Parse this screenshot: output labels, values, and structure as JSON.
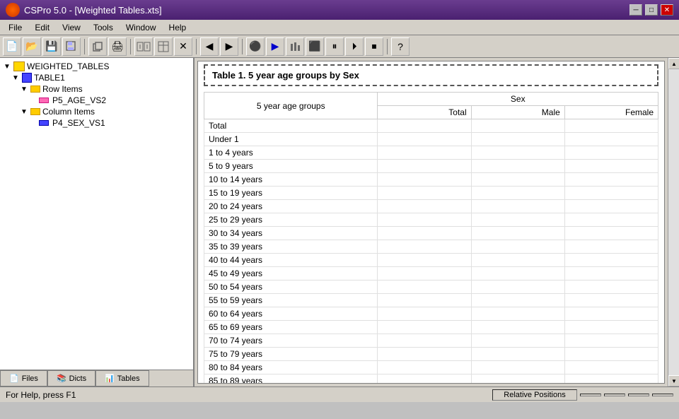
{
  "titlebar": {
    "title": "CSPro 5.0 - [Weighted Tables.xts]",
    "icon": "cspro-icon",
    "controls": [
      "minimize",
      "maximize",
      "close"
    ]
  },
  "menubar": {
    "items": [
      "File",
      "Edit",
      "View",
      "Tools",
      "Window",
      "Help"
    ]
  },
  "toolbar": {
    "buttons": [
      "new",
      "open",
      "save",
      "save-all",
      "copy",
      "print",
      "add-dict",
      "add-table",
      "remove",
      "prev",
      "next",
      "run-off",
      "run",
      "run-freq",
      "stop",
      "pause",
      "play",
      "stop2",
      "help"
    ]
  },
  "left_panel": {
    "tree": {
      "root": "WEIGHTED_TABLES",
      "items": [
        {
          "level": 1,
          "label": "TABLE1",
          "icon": "table"
        },
        {
          "level": 2,
          "label": "Row Items",
          "icon": "folder"
        },
        {
          "level": 3,
          "label": "P5_AGE_VS2",
          "icon": "pink"
        },
        {
          "level": 2,
          "label": "Column Items",
          "icon": "folder"
        },
        {
          "level": 3,
          "label": "P4_SEX_VS1",
          "icon": "blue"
        }
      ]
    },
    "tabs": [
      "Files",
      "Dicts",
      "Tables"
    ]
  },
  "table": {
    "title": "Table 1. 5 year age groups by Sex",
    "col_header_main": "Sex",
    "row_header": "5 year age groups",
    "col_sub_headers": [
      "Total",
      "Male",
      "Female"
    ],
    "rows": [
      "Total",
      "Under 1",
      "1 to 4 years",
      "5 to 9 years",
      "10 to 14 years",
      "15 to 19 years",
      "20 to 24 years",
      "25 to 29 years",
      "30 to 34 years",
      "35 to 39 years",
      "40 to 44 years",
      "45 to 49 years",
      "50 to 54 years",
      "55 to 59 years",
      "60 to 64 years",
      "65 to 69 years",
      "70 to 74 years",
      "75 to 79 years",
      "80 to 84 years",
      "85 to 89 years"
    ]
  },
  "statusbar": {
    "help_text": "For Help, press F1",
    "relative_positions": "Relative Positions",
    "boxes": [
      "",
      "",
      "",
      ""
    ]
  }
}
